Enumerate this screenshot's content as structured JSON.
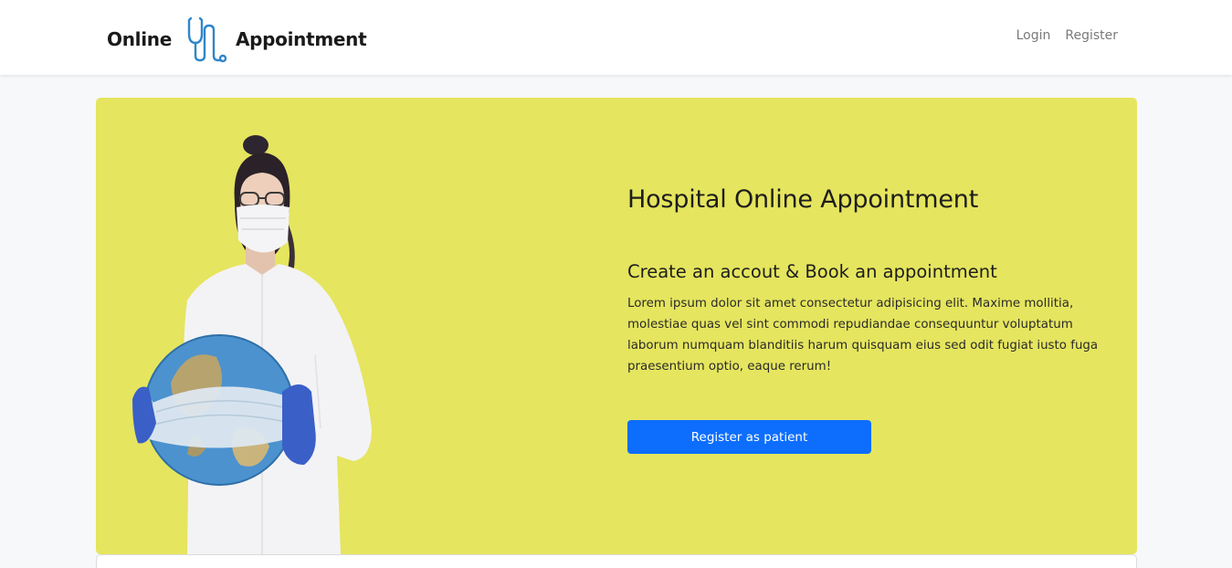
{
  "navbar": {
    "brand_left": "Online",
    "brand_right": "Appointment",
    "links": [
      {
        "label": "Login"
      },
      {
        "label": "Register"
      }
    ]
  },
  "hero": {
    "title": "Hospital Online Appointment",
    "subtitle": "Create an accout & Book an appointment",
    "description": "Lorem ipsum dolor sit amet consectetur adipisicing elit. Maxime mollitia, molestiae quas vel sint commodi repudiandae consequuntur voluptatum laborum numquam blanditiis harum quisquam eius sed odit fugiat iusto fuga praesentium optio, eaque rerum!",
    "button_label": "Register as patient"
  },
  "colors": {
    "hero_background": "#e5e55f",
    "primary": "#0d6efd",
    "logo_blue": "#2f86c8"
  },
  "icons": {
    "brand_logo": "stethoscope-icon"
  }
}
